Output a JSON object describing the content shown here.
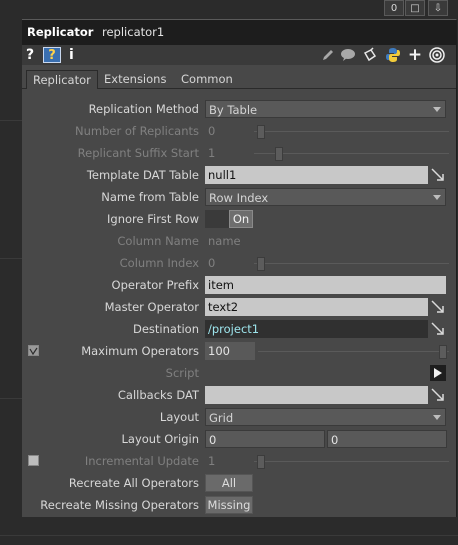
{
  "window_buttons": [
    "0",
    "□",
    "⇩"
  ],
  "header": {
    "op_type": "Replicator",
    "op_name": "replicator1"
  },
  "icon_bar": {
    "help_q": "?",
    "info_i": "i",
    "right_icons": [
      "pencil-icon",
      "comment-icon",
      "clone-icon",
      "python-icon",
      "plus-icon",
      "viewer-icon"
    ]
  },
  "tabs": [
    "Replicator",
    "Extensions",
    "Common"
  ],
  "params": {
    "replication_method": {
      "label": "Replication Method",
      "value": "By Table"
    },
    "num_replicants": {
      "label": "Number of Replicants",
      "value": "0"
    },
    "replicant_suffix_start": {
      "label": "Replicant Suffix Start",
      "value": "1"
    },
    "template_dat_table": {
      "label": "Template DAT Table",
      "value": "null1"
    },
    "name_from_table": {
      "label": "Name from Table",
      "value": "Row Index"
    },
    "ignore_first_row": {
      "label": "Ignore First Row",
      "value": "On"
    },
    "column_name": {
      "label": "Column Name",
      "value": "name"
    },
    "column_index": {
      "label": "Column Index",
      "value": "0"
    },
    "operator_prefix": {
      "label": "Operator Prefix",
      "value": "item"
    },
    "master_operator": {
      "label": "Master Operator",
      "value": "text2"
    },
    "destination": {
      "label": "Destination",
      "value": "/project1"
    },
    "maximum_operators": {
      "label": "Maximum Operators",
      "value": "100"
    },
    "script": {
      "label": "Script",
      "value": ""
    },
    "callbacks_dat": {
      "label": "Callbacks DAT",
      "value": ""
    },
    "layout": {
      "label": "Layout",
      "value": "Grid"
    },
    "layout_origin": {
      "label": "Layout Origin",
      "x": "0",
      "y": "0"
    },
    "incremental_update": {
      "label": "Incremental Update",
      "value": "1"
    },
    "recreate_all": {
      "label": "Recreate All Operators",
      "button": "All"
    },
    "recreate_missing": {
      "label": "Recreate Missing Operators",
      "button": "Missing"
    }
  },
  "colors": {
    "panel": "#484848",
    "title": "#1d1d1d",
    "field_light": "#c8c8c8",
    "destination_text": "#9ee6ee"
  }
}
